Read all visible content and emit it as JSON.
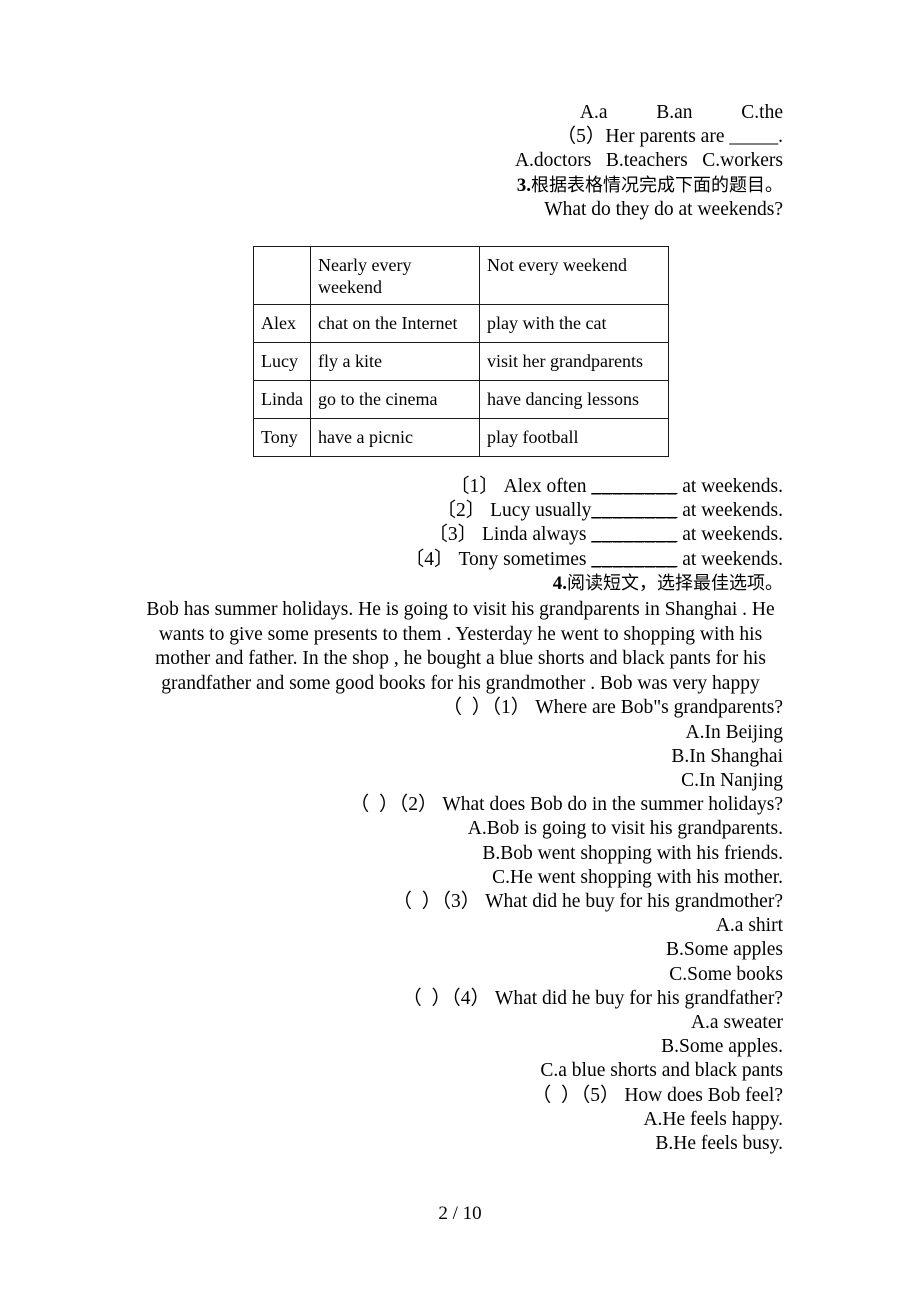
{
  "document": {
    "page_label": "2 / 10"
  },
  "top_fragment": {
    "options_line": "A.a          B.an          C.the",
    "question5_text": "（5）Her parents are _____.",
    "question5_options": "A.doctors   B.teachers   C.workers"
  },
  "section3": {
    "number": "3.",
    "heading_cjk": "根据表格情况完成下面的题目。",
    "prompt": "What do they do at weekends?",
    "table": {
      "headers": [
        "",
        "Nearly every weekend",
        "Not every weekend"
      ],
      "rows": [
        {
          "name": "Alex",
          "nearly": "chat on the Internet",
          "not": "play with the cat"
        },
        {
          "name": "Lucy",
          "nearly": "fly a kite",
          "not": "visit her grandparents"
        },
        {
          "name": "Linda",
          "nearly": "go to the cinema",
          "not": "have dancing lessons"
        },
        {
          "name": "Tony",
          "nearly": "have a picnic",
          "not": "play football"
        }
      ]
    },
    "fill_items": [
      {
        "marker": "〔1〕",
        "text_before": "Alex often",
        "blank": "________",
        "text_after": "at weekends."
      },
      {
        "marker": "〔2〕",
        "text_before": "Lucy usually",
        "blank": "________",
        "text_after": "at weekends."
      },
      {
        "marker": "〔3〕",
        "text_before": "Linda always",
        "blank": "________",
        "text_after": "at weekends."
      },
      {
        "marker": "〔4〕",
        "text_before": "Tony sometimes",
        "blank": "________",
        "text_after": "at weekends."
      }
    ]
  },
  "section4": {
    "number": "4.",
    "heading_cjk": "阅读短文，选择最佳选项。",
    "passage": "Bob has summer holidays. He is going to visit his grandparents in Shanghai . He wants to give some presents to them . Yesterday he went to shopping with his mother and father. In the shop , he bought a blue shorts and black pants for his grandfather and some good books for his grandmother . Bob was very happy",
    "questions": [
      {
        "marker": "（  ）（1）",
        "stem": "Where are Bob\"s grandparents?",
        "options": [
          "A.In Beijing",
          "B.In Shanghai",
          "C.In Nanjing"
        ]
      },
      {
        "marker": "（  ）（2）",
        "stem": "What does Bob do in the summer holidays?",
        "options": [
          "A.Bob is going to visit his grandparents.",
          "B.Bob went shopping with his friends.",
          "C.He went shopping with his mother."
        ]
      },
      {
        "marker": "（  ）（3）",
        "stem": "What did he buy for his grandmother?",
        "options": [
          "A.a shirt",
          "B.Some apples",
          "C.Some books"
        ]
      },
      {
        "marker": "（  ）（4）",
        "stem": "What did he buy for his grandfather?",
        "options": [
          "A.a sweater",
          "B.Some apples.",
          "C.a blue shorts and black pants"
        ]
      },
      {
        "marker": "（  ）（5）",
        "stem": "How does Bob feel?",
        "options": [
          "A.He feels happy.",
          "B.He feels busy."
        ]
      }
    ]
  }
}
